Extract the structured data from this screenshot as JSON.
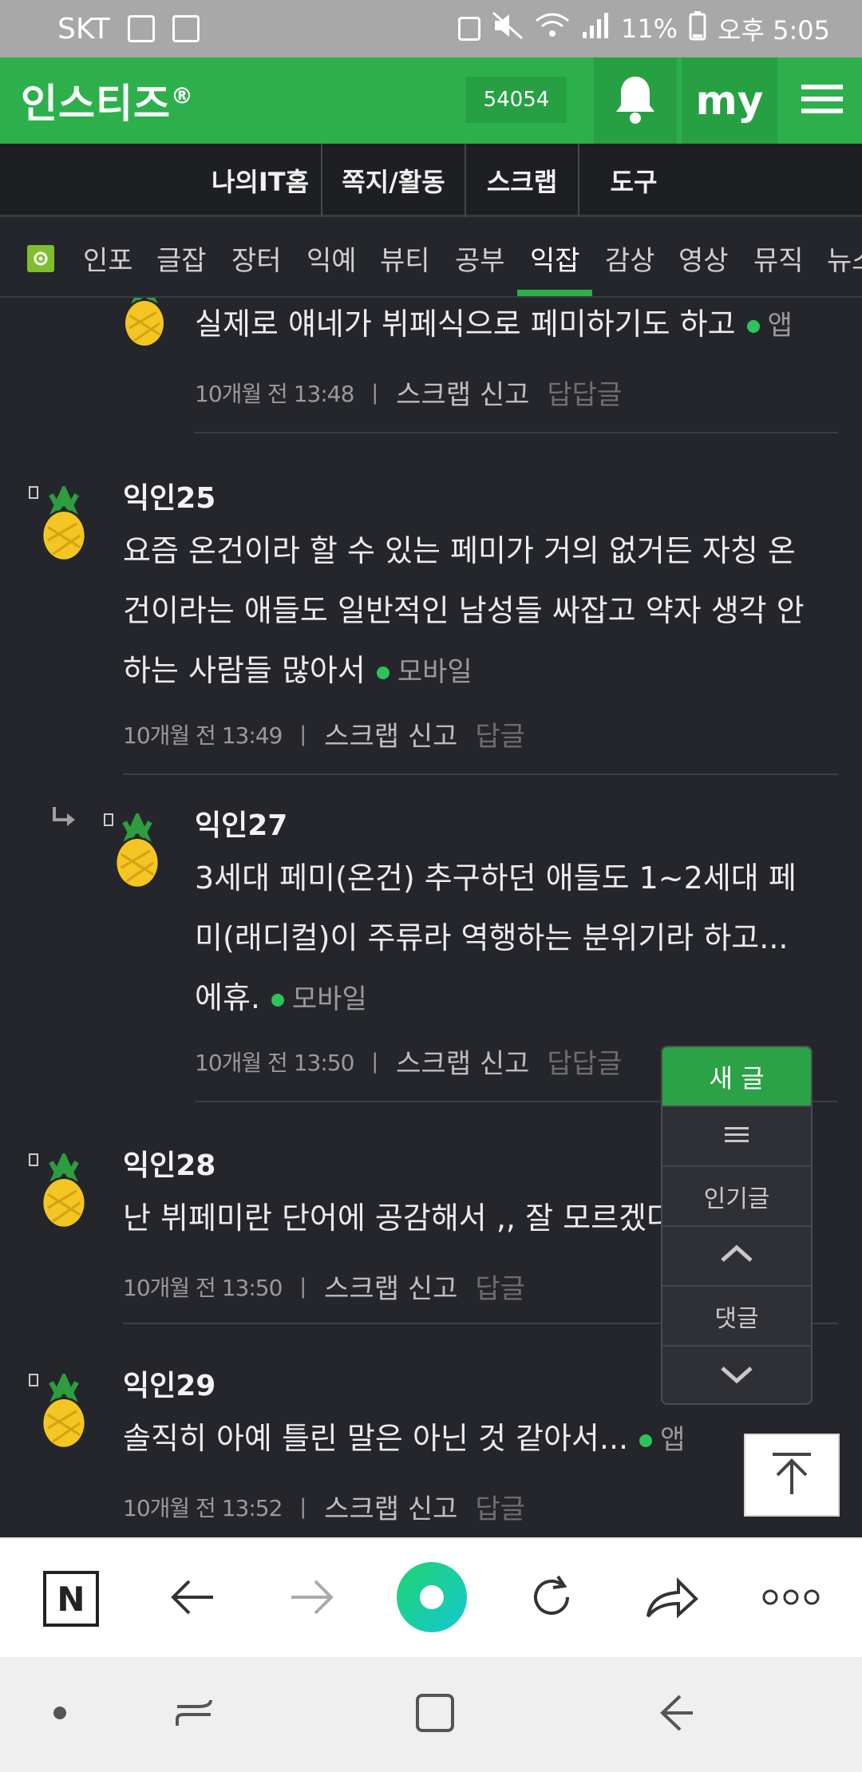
{
  "status": {
    "carrier": "SKT",
    "battery": "11%",
    "time": "오후 5:05"
  },
  "header": {
    "logo": "인스티즈",
    "logo_mark": "®",
    "points": "54054",
    "my_label": "my"
  },
  "subnav": {
    "tabs": [
      "나의IT홈",
      "쪽지/활동",
      "스크랩",
      "도구"
    ]
  },
  "categories": {
    "items": [
      "인포",
      "글잡",
      "장터",
      "익예",
      "뷰티",
      "공부",
      "익잡",
      "감상",
      "영상",
      "뮤직",
      "뉴스"
    ],
    "active": "익잡"
  },
  "comments": [
    {
      "text": "실제로 얘네가 뷔페식으로 페미하기도 하고",
      "source": "앱",
      "time": "10개월 전 13:48",
      "actions": "스크랩 신고",
      "reply": "답답글"
    },
    {
      "nick": "익인25",
      "text_lines": [
        "요즘 온건이라 할 수 있는 페미가 거의 없거든 자칭 온",
        "건이라는 애들도 일반적인 남성들 싸잡고 약자 생각 안",
        "하는 사람들 많아서"
      ],
      "source": "모바일",
      "time": "10개월 전 13:49",
      "actions": "스크랩 신고",
      "reply": "답글"
    },
    {
      "nick": "익인27",
      "text_lines": [
        "3세대 페미(온건) 추구하던 애들도 1~2세대 페",
        "미(래디컬)이 주류라 역행하는 분위기라 하고...",
        "에휴."
      ],
      "source": "모바일",
      "time": "10개월 전 13:50",
      "actions": "스크랩 신고",
      "reply": "답답글"
    },
    {
      "nick": "익인28",
      "text": "난 뷔페미란 단어에 공감해서 ,, 잘 모르겠다",
      "time": "10개월 전 13:50",
      "actions": "스크랩 신고",
      "reply": "답글"
    },
    {
      "nick": "익인29",
      "text": "솔직히 아예 틀린 말은 아닌 것 같아서...",
      "source": "앱",
      "time": "10개월 전 13:52",
      "actions": "스크랩 신고",
      "reply": "답글"
    }
  ],
  "floatnav": {
    "new_post": "새 글",
    "menu_icon": "hamburger-icon",
    "popular": "인기글",
    "up_icon": "chevron-up-icon",
    "comments": "댓글",
    "down_icon": "chevron-down-icon"
  },
  "browser": {
    "n_label": "N"
  },
  "colors": {
    "brand_green": "#2db04b",
    "background": "#25262b",
    "online_dot": "#2ec35a"
  }
}
